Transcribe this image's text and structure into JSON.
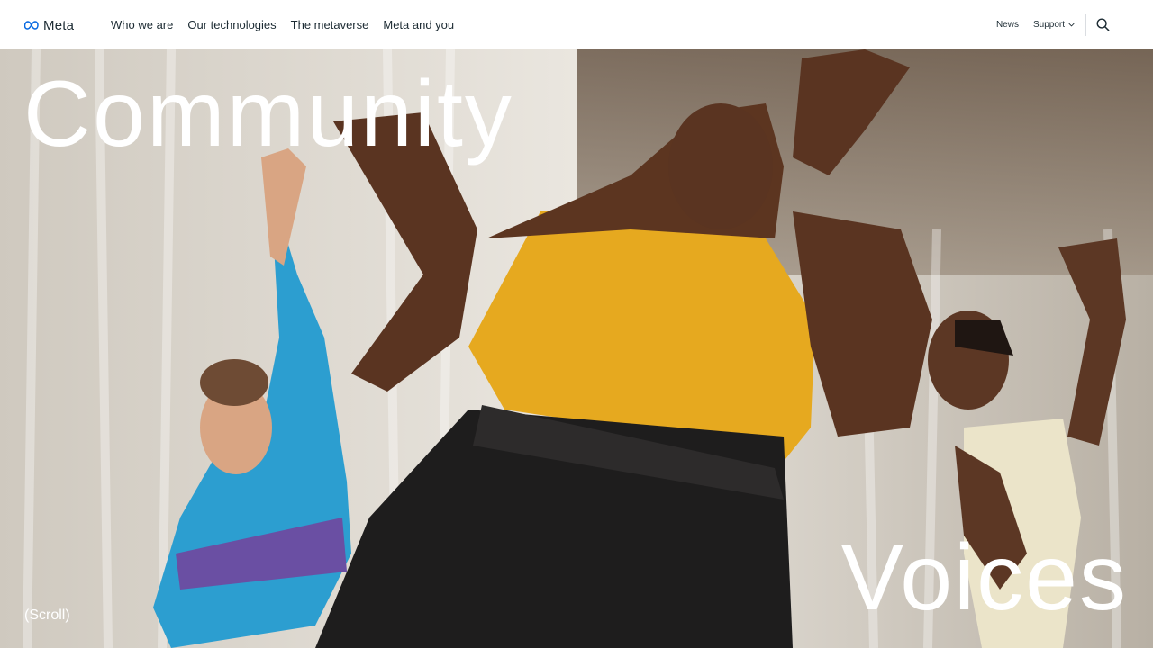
{
  "header": {
    "logo_text": "Meta",
    "nav": [
      "Who we are",
      "Our technologies",
      "The metaverse",
      "Meta and you"
    ],
    "news_label": "News",
    "support_label": "Support",
    "icons": {
      "logo": "meta-infinity-logo-icon",
      "support_caret": "chevron-down-icon",
      "search": "search-icon"
    }
  },
  "hero": {
    "title_top": "Community",
    "title_bottom": "Voices",
    "scroll_label": "(Scroll)",
    "image_description_colors": {
      "top_accent": "#f2b52b",
      "pants": "#1f1f1f",
      "jacket": "#2aa3d4",
      "skin_dark": "#5a3622",
      "skin_light": "#d7a17f",
      "curtain": "#e7e2da"
    }
  }
}
